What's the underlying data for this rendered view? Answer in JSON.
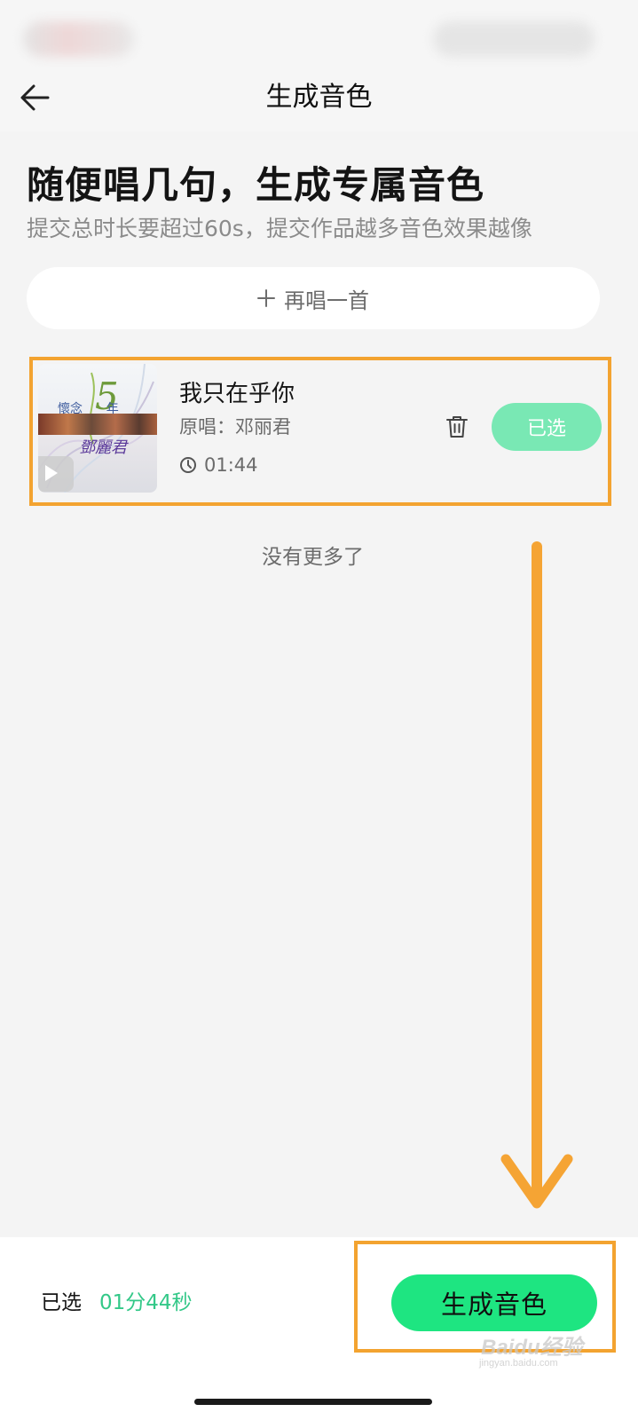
{
  "header": {
    "title": "生成音色"
  },
  "hero": {
    "title": "随便唱几句，生成专属音色",
    "subtitle": "提交总时长要超过60s，提交作品越多音色效果越像"
  },
  "sing_again": {
    "label": "再唱一首"
  },
  "songs": [
    {
      "title": "我只在乎你",
      "original": "原唱：邓丽君",
      "duration": "01:44",
      "selected_label": "已选",
      "cover": {
        "text_top": "懷念",
        "text_number": "5",
        "text_year": "年",
        "text_artist": "鄧麗君"
      }
    }
  ],
  "list_end": "没有更多了",
  "footer": {
    "selected_label": "已选",
    "selected_total": "01分44秒",
    "generate_label": "生成音色"
  },
  "watermark": {
    "main": "Baidu经验",
    "sub": "jingyan.baidu.com"
  },
  "colors": {
    "accent_green": "#1ee581",
    "selected_green": "#79e8b4",
    "duration_green": "#33c888",
    "annotation_orange": "#f3a330"
  },
  "icons": {
    "back": "back-arrow-icon",
    "plus": "plus-icon",
    "play": "play-icon",
    "clock": "clock-icon",
    "trash": "trash-icon"
  }
}
